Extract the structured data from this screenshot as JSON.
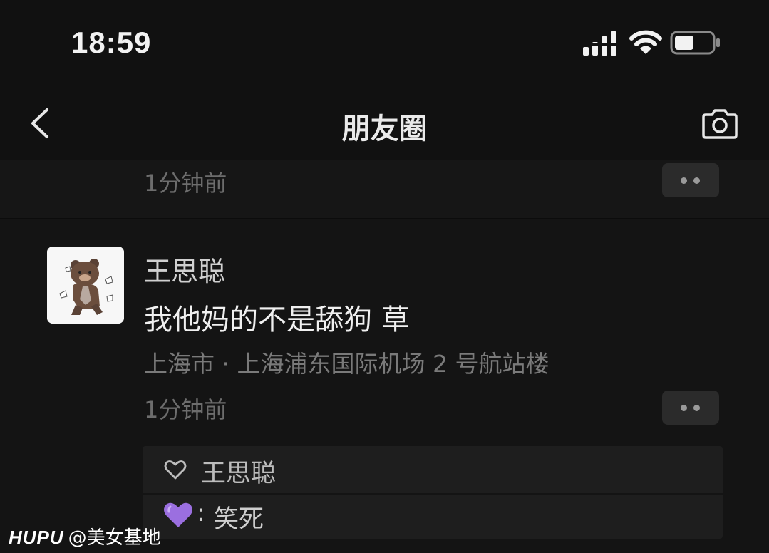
{
  "status_bar": {
    "time": "18:59"
  },
  "nav": {
    "title": "朋友圈",
    "back_icon": "chevron-left-icon",
    "camera_icon": "camera-icon"
  },
  "previous_post": {
    "time": "1分钟前"
  },
  "post": {
    "author": "王思聪",
    "text": "我他妈的不是舔狗 草",
    "location": "上海市 · 上海浦东国际机场 2 号航站楼",
    "time": "1分钟前",
    "likes": [
      "王思聪"
    ],
    "comments": [
      {
        "author_emoji": "💜",
        "separator": ":",
        "text": "笑死"
      }
    ]
  },
  "watermark": {
    "brand": "HUPU",
    "handle": "@美女基地"
  },
  "colors": {
    "background": "#111111",
    "text_primary": "#f0f0f0",
    "text_secondary": "#7a7a7a",
    "comment_heart": "#9b6fe0"
  }
}
